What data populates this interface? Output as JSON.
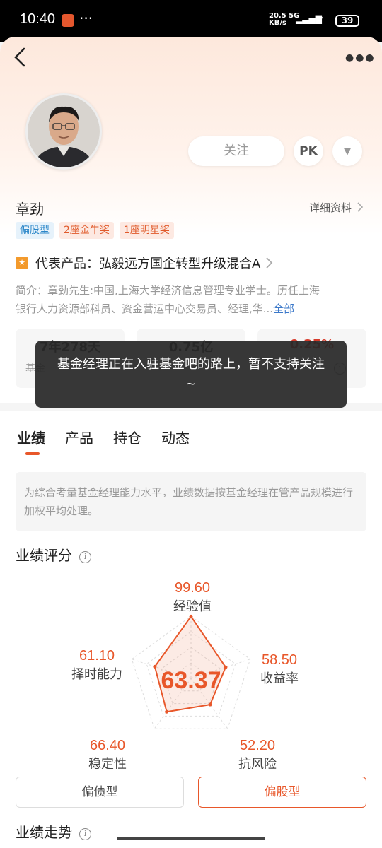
{
  "status_bar": {
    "time": "10:40",
    "speed_value": "20.5",
    "speed_unit": "KB/s",
    "network": "5G",
    "battery": "39"
  },
  "header": {
    "back_icon": "chevron-left-icon",
    "more_icon": "more-dots-icon"
  },
  "profile": {
    "follow_label": "关注",
    "pk_label": "PK",
    "name": "章劲",
    "detail_link": "详细资料",
    "tags": [
      "偏股型",
      "2座金牛奖",
      "1座明星奖"
    ],
    "representative_label": "代表产品：",
    "representative_product": "弘毅远方国企转型升级混合A",
    "intro_line1": "简介：章劲先生:中国,上海大学经济信息管理专业学士。历任上海",
    "intro_line2": "银行人力资源部科员、资金营运中心交易员、经理,华...",
    "intro_more": "全部"
  },
  "stats": [
    {
      "value": "7年278天",
      "label": "基金"
    },
    {
      "value": "0.75亿",
      "label": ""
    },
    {
      "value": "0.25%",
      "label": ""
    }
  ],
  "toast": "基金经理正在入驻基金吧的路上，暂不支持关注~",
  "tabs": [
    "业绩",
    "产品",
    "持仓",
    "动态"
  ],
  "notice": "为综合考量基金经理能力水平，业绩数据按基金经理在管产品规模进行加权平均处理。",
  "score_section": {
    "title": "业绩评分",
    "total": "63.37",
    "dimensions": [
      {
        "label": "经验值",
        "value": "99.60",
        "score": 99.6
      },
      {
        "label": "收益率",
        "value": "58.50",
        "score": 58.5
      },
      {
        "label": "抗风险",
        "value": "52.20",
        "score": 52.2
      },
      {
        "label": "稳定性",
        "value": "66.40",
        "score": 66.4
      },
      {
        "label": "择时能力",
        "value": "61.10",
        "score": 61.1
      }
    ],
    "accent_color": "#e8572a"
  },
  "style_buttons": [
    "偏债型",
    "偏股型"
  ],
  "trend_title": "业绩走势"
}
